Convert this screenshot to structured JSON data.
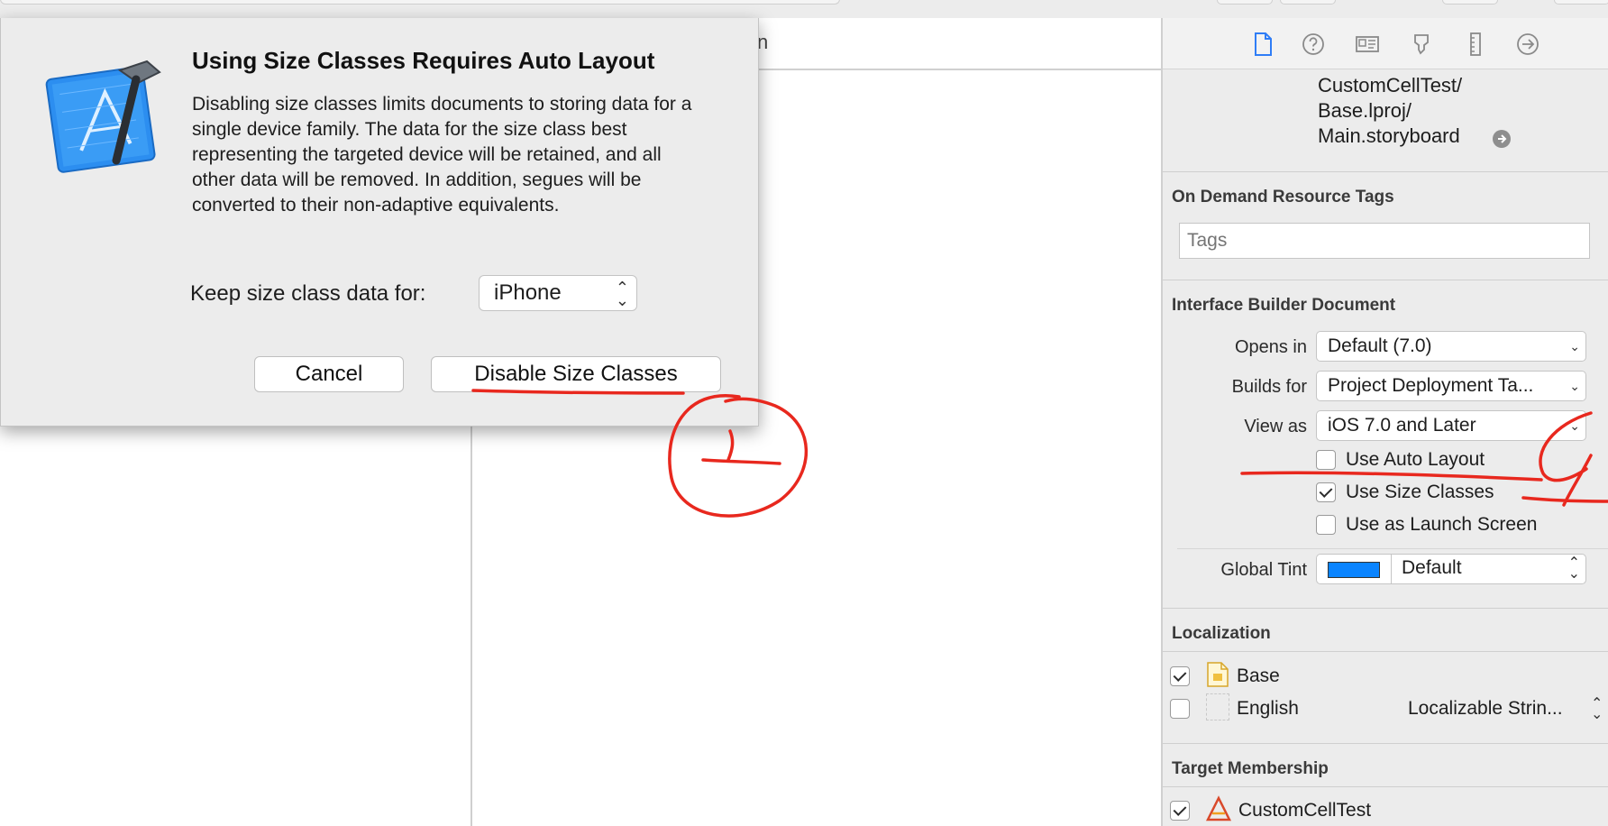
{
  "editor": {
    "header_fragment": "n"
  },
  "dialog": {
    "title": "Using Size Classes Requires Auto Layout",
    "body": "Disabling size classes limits documents to storing data for a single device family. The data for the size class best representing the targeted device will be retained, and all other data will be removed. In addition, segues will be converted to their non-adaptive equivalents.",
    "keep_label": "Keep size class data for:",
    "keep_value": "iPhone",
    "cancel_label": "Cancel",
    "disable_label": "Disable Size Classes",
    "app_icon": "xcode-hammer-icon"
  },
  "inspector": {
    "tabs": [
      "file-icon",
      "help-icon",
      "identity-icon",
      "attributes-icon",
      "size-icon",
      "connections-icon"
    ],
    "full_path": [
      "CustomCellTest/",
      "Base.lproj/",
      "Main.storyboard"
    ],
    "on_demand": {
      "title": "On Demand Resource Tags",
      "placeholder": "Tags"
    },
    "ib_document": {
      "title": "Interface Builder Document",
      "opens_in_label": "Opens in",
      "opens_in_value": "Default (7.0)",
      "builds_for_label": "Builds for",
      "builds_for_value": "Project Deployment Ta...",
      "view_as_label": "View as",
      "view_as_value": "iOS 7.0 and Later",
      "use_auto_layout": "Use Auto Layout",
      "use_auto_layout_checked": false,
      "use_size_classes": "Use Size Classes",
      "use_size_classes_checked": true,
      "use_as_launch": "Use as Launch Screen",
      "use_as_launch_checked": false,
      "global_tint_label": "Global Tint",
      "global_tint_value": "Default",
      "tint_color": "#0a84ff"
    },
    "localization": {
      "title": "Localization",
      "items": [
        {
          "label": "Base",
          "checked": true,
          "extra": ""
        },
        {
          "label": "English",
          "checked": false,
          "extra": "Localizable Strin..."
        }
      ]
    },
    "target_membership": {
      "title": "Target Membership",
      "items": [
        {
          "label": "CustomCellTest",
          "checked": true
        }
      ]
    }
  },
  "annotations": {
    "marks": [
      "1",
      "2"
    ],
    "color": "#e8281e"
  }
}
